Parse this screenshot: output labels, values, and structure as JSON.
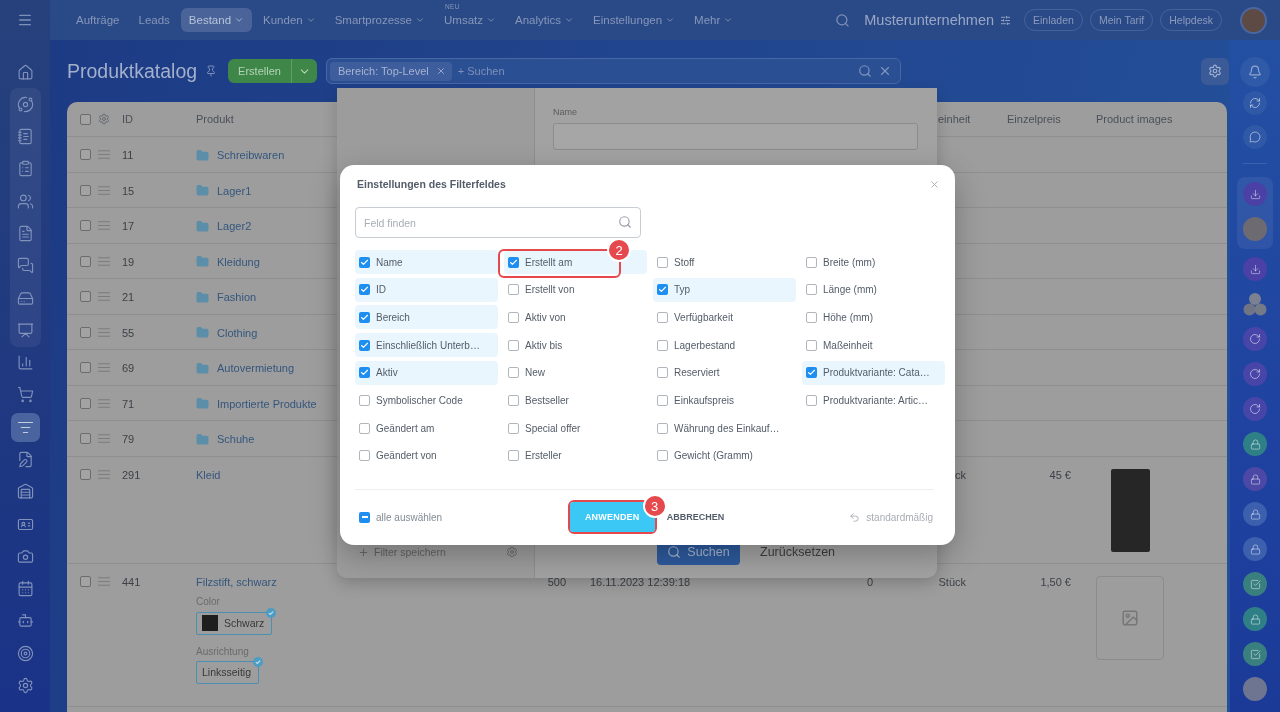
{
  "top_bar": {
    "nav": [
      {
        "label": "Aufträge",
        "selected": false,
        "dropdown": false
      },
      {
        "label": "Leads",
        "selected": false,
        "dropdown": false
      },
      {
        "label": "Bestand",
        "selected": true,
        "dropdown": true
      },
      {
        "label": "Kunden",
        "selected": false,
        "dropdown": true
      },
      {
        "label": "Smartprozesse",
        "selected": false,
        "dropdown": true
      },
      {
        "label": "Umsatz",
        "selected": false,
        "dropdown": true,
        "badge": "NEU"
      },
      {
        "label": "Analytics",
        "selected": false,
        "dropdown": true
      },
      {
        "label": "Einstellungen",
        "selected": false,
        "dropdown": true
      },
      {
        "label": "Mehr",
        "selected": false,
        "dropdown": true
      }
    ],
    "company": "Musterunternehmen",
    "buttons": [
      "Einladen",
      "Mein Tarif",
      "Helpdesk"
    ]
  },
  "left_sidebar": {
    "items": [
      {
        "selected": false
      },
      {
        "selected": false
      },
      {
        "selected": false
      },
      {
        "selected": false
      },
      {
        "selected": false
      },
      {
        "selected": false
      },
      {
        "selected": false
      },
      {
        "selected": false
      },
      {
        "selected": false
      },
      {
        "selected": false
      },
      {
        "selected": false
      },
      {
        "selected": true
      },
      {
        "selected": false
      },
      {
        "selected": false
      },
      {
        "selected": false
      },
      {
        "selected": false
      },
      {
        "selected": false
      },
      {
        "selected": false
      },
      {
        "selected": false
      },
      {
        "selected": false
      }
    ]
  },
  "header": {
    "title": "Produktkatalog",
    "create_button": "Erstellen",
    "filter_tag": "Bereich: Top-Level",
    "search_placeholder": "+ Suchen"
  },
  "table": {
    "header": {
      "checked": false,
      "id": "ID",
      "product": "Produkt",
      "unit": "einheit",
      "price": "Einzelpreis",
      "images": "Product images"
    },
    "rows": [
      {
        "checked": false,
        "id": "11",
        "product": "Schreibwaren",
        "kind": "folder"
      },
      {
        "checked": false,
        "id": "15",
        "product": "Lager1",
        "kind": "folder"
      },
      {
        "checked": false,
        "id": "17",
        "product": "Lager2",
        "kind": "folder"
      },
      {
        "checked": false,
        "id": "19",
        "product": "Kleidung",
        "kind": "folder"
      },
      {
        "checked": false,
        "id": "21",
        "product": "Fashion",
        "kind": "folder"
      },
      {
        "checked": false,
        "id": "55",
        "product": "Clothing",
        "kind": "folder"
      },
      {
        "checked": false,
        "id": "69",
        "product": "Autovermietung",
        "kind": "folder"
      },
      {
        "checked": false,
        "id": "71",
        "product": "Importierte Produkte",
        "kind": "folder"
      },
      {
        "checked": false,
        "id": "79",
        "product": "Schuhe",
        "kind": "folder"
      },
      {
        "checked": false,
        "id": "291",
        "product": "Kleid",
        "kind": "product",
        "unit": "ck",
        "price": "45 €",
        "image": {
          "kind": "photo"
        }
      },
      {
        "checked": false,
        "id": "441",
        "product": "Filzstift, schwarz",
        "kind": "product",
        "properties": [
          {
            "label": "Color",
            "value": "Schwarz",
            "color": "#1e1e1e",
            "selected": true
          },
          {
            "label": "Ausrichtung",
            "value": "Linksseitig",
            "selected": true
          }
        ],
        "column_5": "500",
        "column_6": "16.11.2023 12:39:18",
        "column_7": "0",
        "unit": "Stück",
        "price": "1,50 €",
        "image": {
          "kind": "empty"
        }
      }
    ]
  },
  "filter_panel": {
    "save_filter": "Filter speichern",
    "field_label": "Name",
    "search_button": "Suchen",
    "reset_button": "Zurücksetzen"
  },
  "modal": {
    "title": "Einstellungen des Filterfeldes",
    "search_placeholder": "Feld finden",
    "field_columns": [
      [
        {
          "label": "Name",
          "checked": true
        },
        {
          "label": "ID",
          "checked": true
        },
        {
          "label": "Bereich",
          "checked": true
        },
        {
          "label": "Einschließlich Unterb…",
          "checked": true
        },
        {
          "label": "Aktiv",
          "checked": true
        },
        {
          "label": "Symbolischer Code",
          "checked": false
        },
        {
          "label": "Geändert am",
          "checked": false
        },
        {
          "label": "Geändert von",
          "checked": false
        }
      ],
      [
        {
          "label": "Erstellt am",
          "checked": true,
          "annotation": "2"
        },
        {
          "label": "Erstellt von",
          "checked": false
        },
        {
          "label": "Aktiv von",
          "checked": false
        },
        {
          "label": "Aktiv bis",
          "checked": false
        },
        {
          "label": "New",
          "checked": false
        },
        {
          "label": "Bestseller",
          "checked": false
        },
        {
          "label": "Special offer",
          "checked": false
        },
        {
          "label": "Ersteller",
          "checked": false
        }
      ],
      [
        {
          "label": "Stoff",
          "checked": false
        },
        {
          "label": "Typ",
          "checked": true
        },
        {
          "label": "Verfügbarkeit",
          "checked": false
        },
        {
          "label": "Lagerbestand",
          "checked": false
        },
        {
          "label": "Reserviert",
          "checked": false
        },
        {
          "label": "Einkaufspreis",
          "checked": false
        },
        {
          "label": "Währung des Einkauf…",
          "checked": false
        },
        {
          "label": "Gewicht (Gramm)",
          "checked": false
        }
      ],
      [
        {
          "label": "Breite (mm)",
          "checked": false
        },
        {
          "label": "Länge (mm)",
          "checked": false
        },
        {
          "label": "Höhe (mm)",
          "checked": false
        },
        {
          "label": "Maßeinheit",
          "checked": false
        },
        {
          "label": "Produktvariante: Cata…",
          "checked": true
        },
        {
          "label": "Produktvariante: Artic…",
          "checked": false
        }
      ]
    ],
    "select_all": {
      "label": "alle auswählen",
      "indeterminate": true
    },
    "apply_button": {
      "label": "ANWENDEN",
      "annotation": "3"
    },
    "cancel_button": "ABBRECHEN",
    "reset_link": "standardmäßig"
  }
}
